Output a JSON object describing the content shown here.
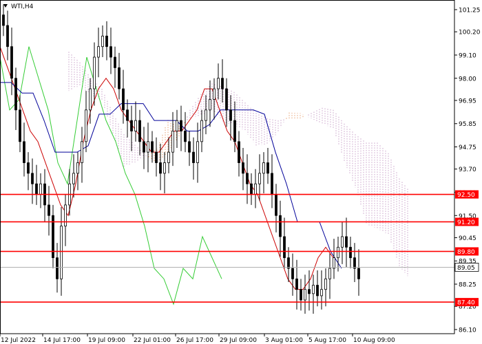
{
  "chart_data": {
    "type": "candlestick",
    "title": "WTI,H4",
    "ylim": [
      86.1,
      101.25
    ],
    "y_ticks": [
      101.25,
      100.2,
      99.1,
      98.0,
      96.95,
      95.85,
      94.75,
      93.7,
      92.6,
      91.5,
      90.45,
      89.35,
      88.25,
      87.2,
      86.1
    ],
    "x_ticks": [
      "12 Jul 2022",
      "14 Jul 17:00",
      "19 Jul 09:00",
      "22 Jul 01:00",
      "26 Jul 17:00",
      "29 Jul 09:00",
      "3 Aug 01:00",
      "5 Aug 17:00",
      "10 Aug 09:00"
    ],
    "horizontal_levels": [
      {
        "value": 92.5,
        "label": "92.50"
      },
      {
        "value": 91.2,
        "label": "91.20"
      },
      {
        "value": 89.8,
        "label": "89.80"
      },
      {
        "value": 87.4,
        "label": "87.40"
      }
    ],
    "current_price": {
      "value": 89.05,
      "label": "89.05"
    },
    "candles_close": [
      100.5,
      99.5,
      98.0,
      96.5,
      95.0,
      94.0,
      93.5,
      93.0,
      92.5,
      93.0,
      92.0,
      91.5,
      89.5,
      88.5,
      91.0,
      92.0,
      93.0,
      93.5,
      94.0,
      95.0,
      96.5,
      97.5,
      99.0,
      99.5,
      100.0,
      99.5,
      99.0,
      98.5,
      97.5,
      96.5,
      96.0,
      95.5,
      96.0,
      95.0,
      94.5,
      95.0,
      94.5,
      94.0,
      93.5,
      94.0,
      94.5,
      95.5,
      96.0,
      95.5,
      95.0,
      94.5,
      94.0,
      95.0,
      96.0,
      96.5,
      97.0,
      97.5,
      98.0,
      97.5,
      96.5,
      96.0,
      95.0,
      94.0,
      93.5,
      93.0,
      92.5,
      93.0,
      93.5,
      94.0,
      93.5,
      92.5,
      91.5,
      90.5,
      89.5,
      89.0,
      88.5,
      88.0,
      87.5,
      88.0,
      87.8,
      88.2,
      87.7,
      88.0,
      88.5,
      89.0,
      89.5,
      90.0,
      90.5,
      90.0,
      89.5,
      89.0,
      88.5
    ],
    "ichimoku": {
      "tenkan_sen": [
        99.5,
        98.5,
        97.5,
        96.5,
        95.5,
        95.0,
        94.0,
        93.0,
        92.0,
        91.5,
        93.0,
        95.0,
        96.5,
        97.5,
        98.0,
        97.5,
        96.5,
        96.0,
        95.5,
        95.0,
        94.5,
        94.5,
        95.0,
        95.5,
        95.5,
        96.0,
        96.5,
        97.5,
        97.5,
        96.5,
        95.5,
        95.0,
        94.0,
        93.0,
        92.5,
        91.5,
        90.5,
        89.5,
        88.5,
        88.0,
        88.0,
        88.5,
        89.5,
        90.0,
        89.5
      ],
      "kijun_sen": [
        97.8,
        97.8,
        97.3,
        97.3,
        96.0,
        94.5,
        94.5,
        94.5,
        94.8,
        96.3,
        96.3,
        96.8,
        96.8,
        96.8,
        96.0,
        96.0,
        96.0,
        95.5,
        95.5,
        95.8,
        96.5,
        96.5,
        96.5,
        96.5,
        96.3,
        94.5,
        93.0,
        91.2,
        91.2,
        91.2,
        89.8,
        89.0
      ],
      "chikou_span": [
        99.0,
        96.5,
        97.0,
        99.5,
        98.0,
        96.5,
        94.0,
        93.0,
        96.0,
        99.0,
        97.5,
        96.0,
        95.0,
        93.5,
        92.5,
        91.0,
        89.0,
        88.5,
        87.3,
        89.0,
        88.5,
        90.5,
        89.5,
        88.5
      ]
    }
  }
}
